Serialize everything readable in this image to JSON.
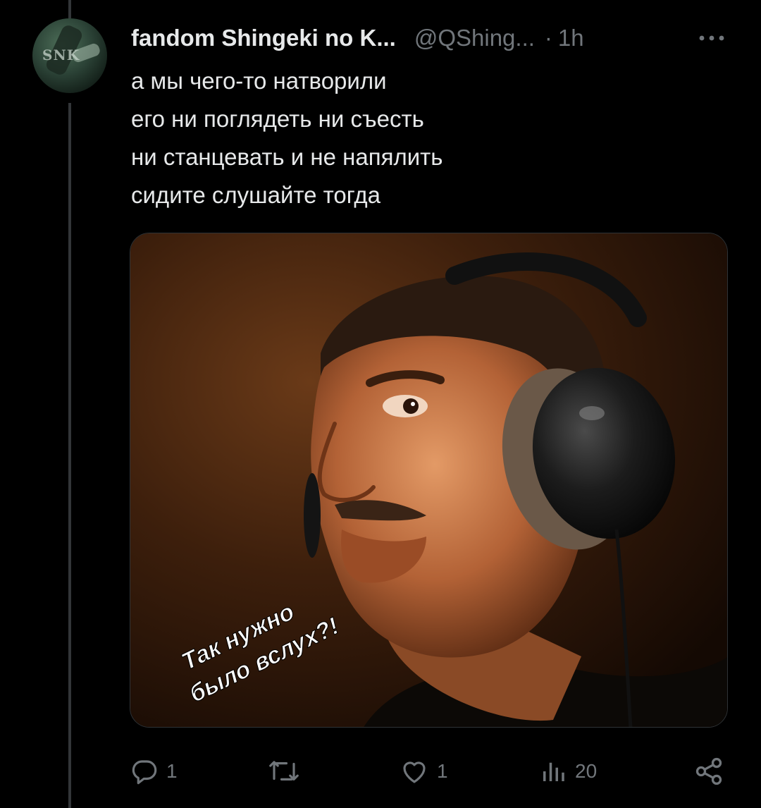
{
  "tweet": {
    "display_name": "fandom Shingeki no K...",
    "handle": "@QShing...",
    "separator": "·",
    "time": "1h",
    "avatar_label": "SNK",
    "text_lines": [
      "а мы чего-то натворили",
      "его ни поглядеть ни съесть",
      "ни станцевать и не напялить",
      "сидите слушайте тогда"
    ]
  },
  "media": {
    "caption_line1": "Так нужно",
    "caption_line2": "было вслух?!"
  },
  "actions": {
    "reply_count": "1",
    "repost_count": "",
    "like_count": "1",
    "views_count": "20"
  },
  "colors": {
    "background": "#000000",
    "text_primary": "#e7e9ea",
    "text_secondary": "#71767b",
    "thread_line": "#333639",
    "media_border": "#2f3336"
  },
  "icons": {
    "reply": "reply-icon",
    "repost": "repost-icon",
    "like": "like-icon",
    "views": "views-icon",
    "share": "share-icon",
    "more": "more-icon"
  }
}
